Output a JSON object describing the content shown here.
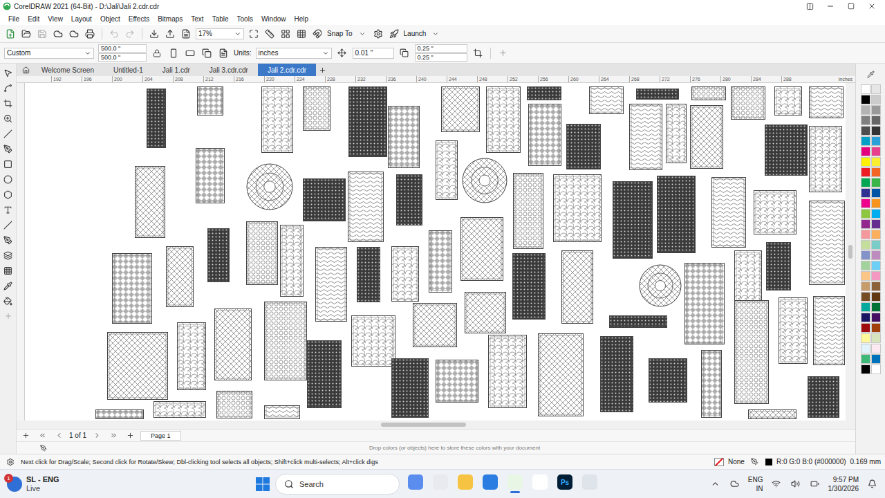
{
  "window": {
    "title": "CorelDRAW 2021 (64-Bit) - D:\\Jali\\Jali 2.cdr.cdr"
  },
  "menu": [
    "File",
    "Edit",
    "View",
    "Layout",
    "Object",
    "Effects",
    "Bitmaps",
    "Text",
    "Table",
    "Tools",
    "Window",
    "Help"
  ],
  "toolbar": {
    "zoom": "17%",
    "snap": "Snap To",
    "launch": "Launch"
  },
  "property_bar": {
    "preset": "Custom",
    "width": "500.0 \"",
    "height": "500.0 \"",
    "units_label": "Units:",
    "units": "inches",
    "nudge": "0.01 \"",
    "dup_x": "0.25 \"",
    "dup_y": "0.25 \""
  },
  "tabs": [
    {
      "label": "Welcome Screen",
      "selected": false
    },
    {
      "label": "Untitled-1",
      "selected": false
    },
    {
      "label": "Jali 1.cdr",
      "selected": false
    },
    {
      "label": "Jali 3.cdr.cdr",
      "selected": false
    },
    {
      "label": "Jali 2.cdr.cdr",
      "selected": true
    }
  ],
  "ruler": {
    "labels": [
      "192",
      "196",
      "200",
      "204",
      "208",
      "212",
      "216",
      "220",
      "224",
      "228",
      "232",
      "236",
      "240",
      "244",
      "248",
      "252",
      "256",
      "260",
      "264",
      "268",
      "272",
      "276",
      "280",
      "284",
      "288"
    ],
    "unit": "inches"
  },
  "pager": {
    "count": "1 of 1",
    "pages": [
      {
        "label": "Page 1",
        "selected": true
      }
    ]
  },
  "color_docker": {
    "hint": "Drop colors (or objects) here to store these colors with your document"
  },
  "status_bar": {
    "hint": "Next click for Drag/Scale; Second click for Rotate/Skew; Dbl-clicking tool selects all objects; Shift+click multi-selects; Alt+click digs",
    "fill": "None",
    "color": "R:0 G:0 B:0 (#000000)",
    "outline": "0.169 mm"
  },
  "palette": [
    {
      "color": "#ffffff"
    },
    {
      "color": "#e6e6e6"
    },
    {
      "color": "#000000"
    },
    {
      "color": "#cccccc"
    },
    {
      "color": "#b3b3b3"
    },
    {
      "color": "#999999"
    },
    {
      "color": "#808080"
    },
    {
      "color": "#666666"
    },
    {
      "color": "#4d4d4d"
    },
    {
      "color": "#333333"
    },
    {
      "color": "#00a0c6"
    },
    {
      "color": "#2b9fd8"
    },
    {
      "color": "#e4007d"
    },
    {
      "color": "#e83f8c"
    },
    {
      "color": "#fff200"
    },
    {
      "color": "#f9ed32"
    },
    {
      "color": "#ed1c24"
    },
    {
      "color": "#f26522"
    },
    {
      "color": "#00a651"
    },
    {
      "color": "#39b54a"
    },
    {
      "color": "#2e3192"
    },
    {
      "color": "#0054a6"
    },
    {
      "color": "#ec008c"
    },
    {
      "color": "#f7941d"
    },
    {
      "color": "#8dc63f"
    },
    {
      "color": "#00aeef"
    },
    {
      "color": "#92278f"
    },
    {
      "color": "#662d91"
    },
    {
      "color": "#f5989d"
    },
    {
      "color": "#fbaf5d"
    },
    {
      "color": "#c4df9b"
    },
    {
      "color": "#7accc8"
    },
    {
      "color": "#8393ca"
    },
    {
      "color": "#bd8cbf"
    },
    {
      "color": "#a3d39c"
    },
    {
      "color": "#6dcff6"
    },
    {
      "color": "#fdc689"
    },
    {
      "color": "#f49ac2"
    },
    {
      "color": "#c69c6d"
    },
    {
      "color": "#8c6239"
    },
    {
      "color": "#754c24"
    },
    {
      "color": "#603913"
    },
    {
      "color": "#00a99d"
    },
    {
      "color": "#007236"
    },
    {
      "color": "#1b1464"
    },
    {
      "color": "#440e62"
    },
    {
      "color": "#9e0b0f"
    },
    {
      "color": "#a0410d"
    },
    {
      "color": "#fff799"
    },
    {
      "color": "#d7e3bc"
    },
    {
      "color": "#e1f4fd"
    },
    {
      "color": "#fde9f1"
    },
    {
      "color": "#3cb878"
    },
    {
      "color": "#0072bc"
    },
    {
      "color": "#000000"
    },
    {
      "color": "#ffffff"
    }
  ],
  "taskbar": {
    "badge": "1",
    "weather": "SL - ENG",
    "weather_sub": "Live",
    "search": "Search",
    "app_label": "Ps",
    "lang": "ENG",
    "region": "IN",
    "time": "9:57 PM",
    "date": "1/30/2026",
    "apps": [
      {
        "running": false
      },
      {
        "running": false
      },
      {
        "running": false
      },
      {
        "running": false
      },
      {
        "running": true
      },
      {
        "running": false
      },
      {
        "running": false
      },
      {
        "running": false
      }
    ]
  }
}
